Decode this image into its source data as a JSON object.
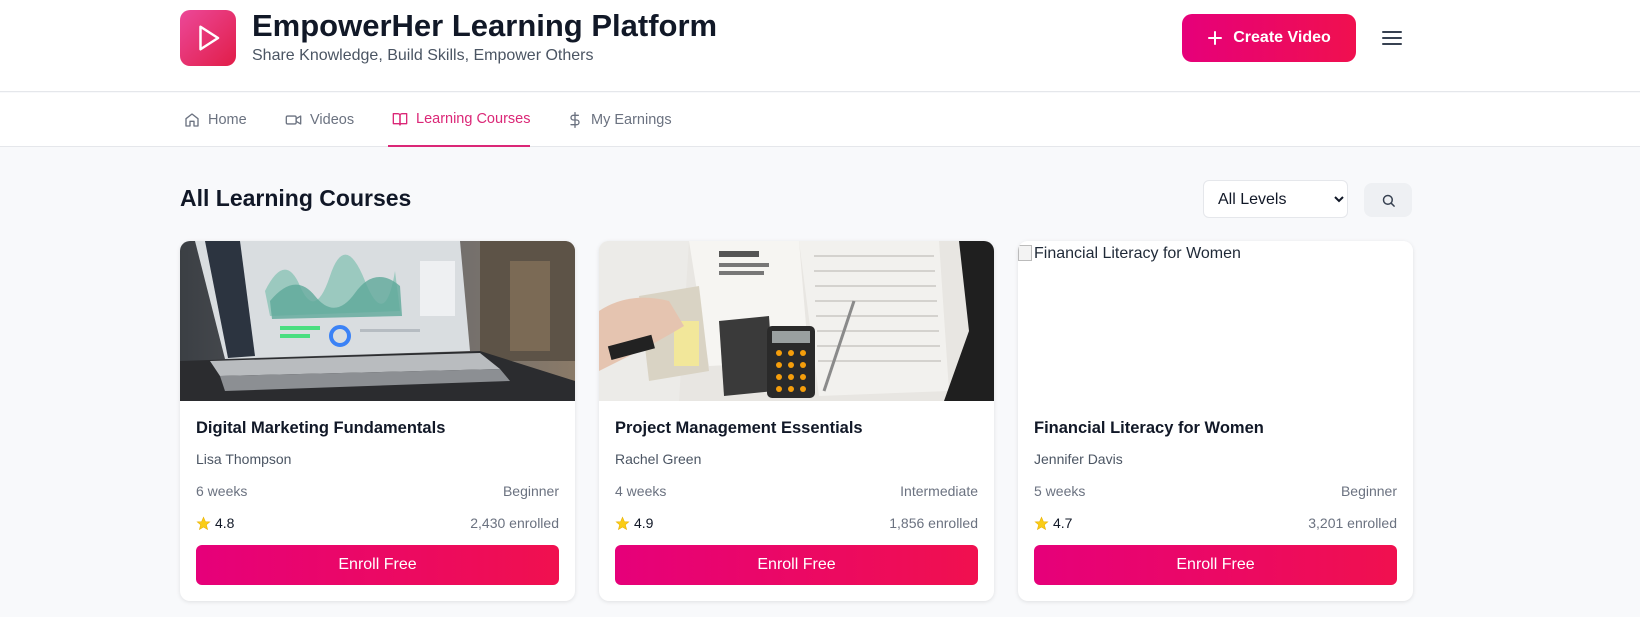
{
  "header": {
    "title": "EmpowerHer Learning Platform",
    "subtitle": "Share Knowledge, Build Skills, Empower Others",
    "create_label": "Create Video",
    "accent": "#e6007a"
  },
  "nav": {
    "tabs": [
      {
        "label": "Home",
        "icon": "home-icon"
      },
      {
        "label": "Videos",
        "icon": "video-icon"
      },
      {
        "label": "Learning Courses",
        "icon": "book-icon",
        "active": true
      },
      {
        "label": "My Earnings",
        "icon": "dollar-icon"
      }
    ]
  },
  "section": {
    "title": "All Learning Courses",
    "level_options": [
      "All Levels"
    ],
    "level_selected": "All Levels"
  },
  "courses": [
    {
      "title": "Digital Marketing Fundamentals",
      "author": "Lisa Thompson",
      "duration": "6 weeks",
      "level": "Beginner",
      "rating": "4.8",
      "enrolled": "2,430 enrolled",
      "button": "Enroll Free",
      "image": "laptop-analytics-photo"
    },
    {
      "title": "Project Management Essentials",
      "author": "Rachel Green",
      "duration": "4 weeks",
      "level": "Intermediate",
      "rating": "4.9",
      "enrolled": "1,856 enrolled",
      "button": "Enroll Free",
      "image": "calculator-documents-photo"
    },
    {
      "title": "Financial Literacy for Women",
      "author": "Jennifer Davis",
      "duration": "5 weeks",
      "level": "Beginner",
      "rating": "4.7",
      "enrolled": "3,201 enrolled",
      "button": "Enroll Free",
      "image_alt": "Financial Literacy for Women"
    }
  ]
}
